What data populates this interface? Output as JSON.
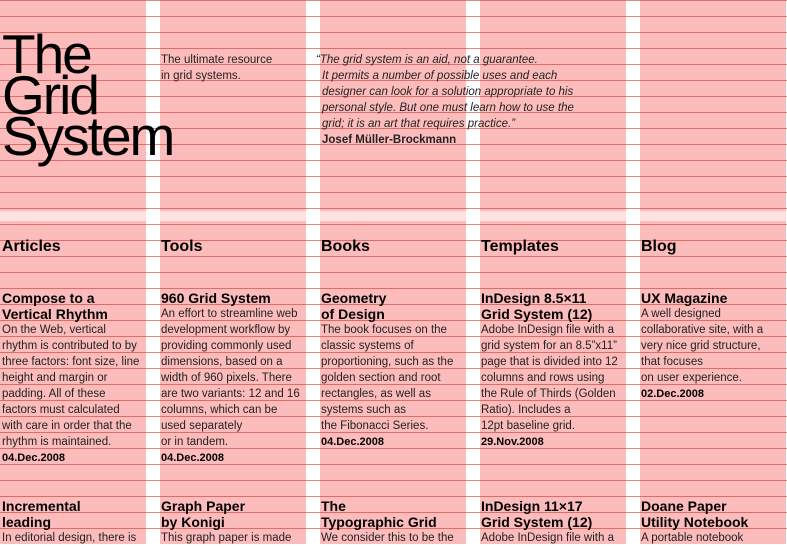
{
  "header": {
    "logo_lines": [
      "The",
      "Grid",
      "System"
    ],
    "tagline_lines": [
      "The ultimate resource",
      "in grid systems."
    ],
    "quote_lines": [
      "“The grid system is an aid, not a guarantee.",
      "It permits a number of possible uses and each",
      "designer can look for a solution appropriate to his",
      "personal style. But one must learn how to use the",
      "grid; it is an art that requires practice.”"
    ],
    "quote_author": "Josef Müller-Brockmann"
  },
  "sections": [
    {
      "title": "Articles",
      "entries": [
        {
          "title_lines": [
            "Compose to a",
            "Vertical Rhythm"
          ],
          "text_lines": [
            "On the Web, vertical",
            "rhythm is contributed to by",
            "three factors: font size, line",
            "height and margin or",
            "padding. All of these",
            "factors must calculated",
            "with care in order that the",
            "rhythm is maintained."
          ],
          "date": "04.Dec.2008"
        },
        {
          "title_lines": [
            "Incremental",
            "leading"
          ],
          "text_lines": [
            "In editorial design, there is"
          ],
          "date": ""
        }
      ]
    },
    {
      "title": "Tools",
      "entries": [
        {
          "title_lines": [
            "960 Grid System"
          ],
          "text_lines": [
            "An effort to streamline web",
            "development workflow by",
            "providing commonly used",
            "dimensions, based on a",
            "width of 960 pixels. There",
            "are two variants: 12 and 16",
            "columns, which can be",
            "used separately",
            "or in tandem."
          ],
          "date": "04.Dec.2008"
        },
        {
          "title_lines": [
            "Graph Paper",
            "by Konigi"
          ],
          "text_lines": [
            "This graph paper is made"
          ],
          "date": ""
        }
      ]
    },
    {
      "title": "Books",
      "entries": [
        {
          "title_lines": [
            "Geometry",
            "of Design"
          ],
          "text_lines": [
            "The book focuses on the",
            "classic systems of",
            "proportioning, such as the",
            "golden section and root",
            "rectangles, as well as",
            "systems such as",
            "the Fibonacci Series."
          ],
          "date": "04.Dec.2008"
        },
        {
          "title_lines": [
            "The",
            "Typographic Grid"
          ],
          "text_lines": [
            "We consider this to be the"
          ],
          "date": ""
        }
      ]
    },
    {
      "title": "Templates",
      "entries": [
        {
          "title_lines": [
            "InDesign 8.5×11",
            "Grid System (12)"
          ],
          "text_lines": [
            "Adobe InDesign file with a",
            "grid system for an 8.5”x11”",
            "page that is divided into 12",
            "columns and rows using",
            "the Rule of Thirds (Golden",
            "Ratio). Includes a",
            "12pt baseline grid."
          ],
          "date": "29.Nov.2008"
        },
        {
          "title_lines": [
            "InDesign 11×17",
            "Grid System (12)"
          ],
          "text_lines": [
            "Adobe InDesign file with a"
          ],
          "date": ""
        }
      ]
    },
    {
      "title": "Blog",
      "entries": [
        {
          "title_lines": [
            "UX Magazine"
          ],
          "text_lines": [
            "A well designed",
            "collaborative site, with a",
            "very nice grid structure,",
            "that focuses",
            "on user experience."
          ],
          "date": "02.Dec.2008"
        },
        {
          "title_lines": [
            "Doane Paper",
            "Utility Notebook"
          ],
          "text_lines": [
            "A portable notebook"
          ],
          "date": ""
        }
      ]
    }
  ]
}
